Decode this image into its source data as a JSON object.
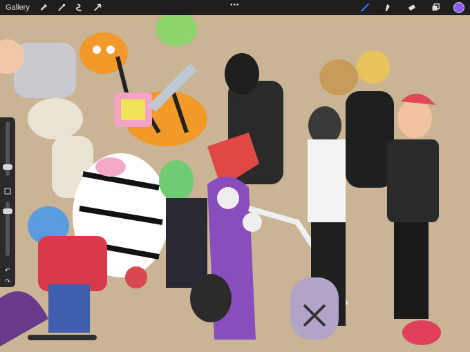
{
  "toolbar": {
    "gallery_label": "Gallery",
    "left_tools": [
      "wrench-icon",
      "magic-wand-icon",
      "selection-icon",
      "transform-arrow-icon"
    ],
    "more_icon": "ellipsis-icon",
    "right_tools": [
      "brush-icon",
      "smudge-icon",
      "eraser-icon",
      "layers-icon"
    ],
    "active_tool": "brush-icon",
    "accent_color": "#2f7bff",
    "current_color": "#8e5cf0"
  },
  "sidebar": {
    "brush_size_level": 0.22,
    "opacity_level": 0.45,
    "buttons": [
      "modify-button",
      "undo-button",
      "redo-button"
    ]
  },
  "canvas": {
    "background_color": "#c9b595",
    "artwork_description": ""
  }
}
